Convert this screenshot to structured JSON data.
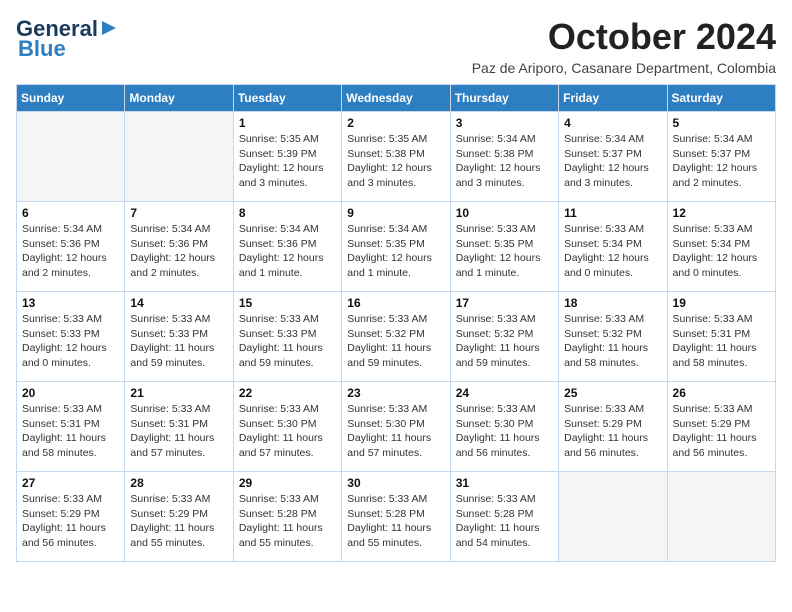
{
  "logo": {
    "line1": "General",
    "line2": "Blue"
  },
  "title": "October 2024",
  "subtitle": "Paz de Ariporo, Casanare Department, Colombia",
  "days_of_week": [
    "Sunday",
    "Monday",
    "Tuesday",
    "Wednesday",
    "Thursday",
    "Friday",
    "Saturday"
  ],
  "weeks": [
    [
      {
        "day": "",
        "info": ""
      },
      {
        "day": "",
        "info": ""
      },
      {
        "day": "1",
        "info": "Sunrise: 5:35 AM\nSunset: 5:39 PM\nDaylight: 12 hours and 3 minutes."
      },
      {
        "day": "2",
        "info": "Sunrise: 5:35 AM\nSunset: 5:38 PM\nDaylight: 12 hours and 3 minutes."
      },
      {
        "day": "3",
        "info": "Sunrise: 5:34 AM\nSunset: 5:38 PM\nDaylight: 12 hours and 3 minutes."
      },
      {
        "day": "4",
        "info": "Sunrise: 5:34 AM\nSunset: 5:37 PM\nDaylight: 12 hours and 3 minutes."
      },
      {
        "day": "5",
        "info": "Sunrise: 5:34 AM\nSunset: 5:37 PM\nDaylight: 12 hours and 2 minutes."
      }
    ],
    [
      {
        "day": "6",
        "info": "Sunrise: 5:34 AM\nSunset: 5:36 PM\nDaylight: 12 hours and 2 minutes."
      },
      {
        "day": "7",
        "info": "Sunrise: 5:34 AM\nSunset: 5:36 PM\nDaylight: 12 hours and 2 minutes."
      },
      {
        "day": "8",
        "info": "Sunrise: 5:34 AM\nSunset: 5:36 PM\nDaylight: 12 hours and 1 minute."
      },
      {
        "day": "9",
        "info": "Sunrise: 5:34 AM\nSunset: 5:35 PM\nDaylight: 12 hours and 1 minute."
      },
      {
        "day": "10",
        "info": "Sunrise: 5:33 AM\nSunset: 5:35 PM\nDaylight: 12 hours and 1 minute."
      },
      {
        "day": "11",
        "info": "Sunrise: 5:33 AM\nSunset: 5:34 PM\nDaylight: 12 hours and 0 minutes."
      },
      {
        "day": "12",
        "info": "Sunrise: 5:33 AM\nSunset: 5:34 PM\nDaylight: 12 hours and 0 minutes."
      }
    ],
    [
      {
        "day": "13",
        "info": "Sunrise: 5:33 AM\nSunset: 5:33 PM\nDaylight: 12 hours and 0 minutes."
      },
      {
        "day": "14",
        "info": "Sunrise: 5:33 AM\nSunset: 5:33 PM\nDaylight: 11 hours and 59 minutes."
      },
      {
        "day": "15",
        "info": "Sunrise: 5:33 AM\nSunset: 5:33 PM\nDaylight: 11 hours and 59 minutes."
      },
      {
        "day": "16",
        "info": "Sunrise: 5:33 AM\nSunset: 5:32 PM\nDaylight: 11 hours and 59 minutes."
      },
      {
        "day": "17",
        "info": "Sunrise: 5:33 AM\nSunset: 5:32 PM\nDaylight: 11 hours and 59 minutes."
      },
      {
        "day": "18",
        "info": "Sunrise: 5:33 AM\nSunset: 5:32 PM\nDaylight: 11 hours and 58 minutes."
      },
      {
        "day": "19",
        "info": "Sunrise: 5:33 AM\nSunset: 5:31 PM\nDaylight: 11 hours and 58 minutes."
      }
    ],
    [
      {
        "day": "20",
        "info": "Sunrise: 5:33 AM\nSunset: 5:31 PM\nDaylight: 11 hours and 58 minutes."
      },
      {
        "day": "21",
        "info": "Sunrise: 5:33 AM\nSunset: 5:31 PM\nDaylight: 11 hours and 57 minutes."
      },
      {
        "day": "22",
        "info": "Sunrise: 5:33 AM\nSunset: 5:30 PM\nDaylight: 11 hours and 57 minutes."
      },
      {
        "day": "23",
        "info": "Sunrise: 5:33 AM\nSunset: 5:30 PM\nDaylight: 11 hours and 57 minutes."
      },
      {
        "day": "24",
        "info": "Sunrise: 5:33 AM\nSunset: 5:30 PM\nDaylight: 11 hours and 56 minutes."
      },
      {
        "day": "25",
        "info": "Sunrise: 5:33 AM\nSunset: 5:29 PM\nDaylight: 11 hours and 56 minutes."
      },
      {
        "day": "26",
        "info": "Sunrise: 5:33 AM\nSunset: 5:29 PM\nDaylight: 11 hours and 56 minutes."
      }
    ],
    [
      {
        "day": "27",
        "info": "Sunrise: 5:33 AM\nSunset: 5:29 PM\nDaylight: 11 hours and 56 minutes."
      },
      {
        "day": "28",
        "info": "Sunrise: 5:33 AM\nSunset: 5:29 PM\nDaylight: 11 hours and 55 minutes."
      },
      {
        "day": "29",
        "info": "Sunrise: 5:33 AM\nSunset: 5:28 PM\nDaylight: 11 hours and 55 minutes."
      },
      {
        "day": "30",
        "info": "Sunrise: 5:33 AM\nSunset: 5:28 PM\nDaylight: 11 hours and 55 minutes."
      },
      {
        "day": "31",
        "info": "Sunrise: 5:33 AM\nSunset: 5:28 PM\nDaylight: 11 hours and 54 minutes."
      },
      {
        "day": "",
        "info": ""
      },
      {
        "day": "",
        "info": ""
      }
    ]
  ]
}
